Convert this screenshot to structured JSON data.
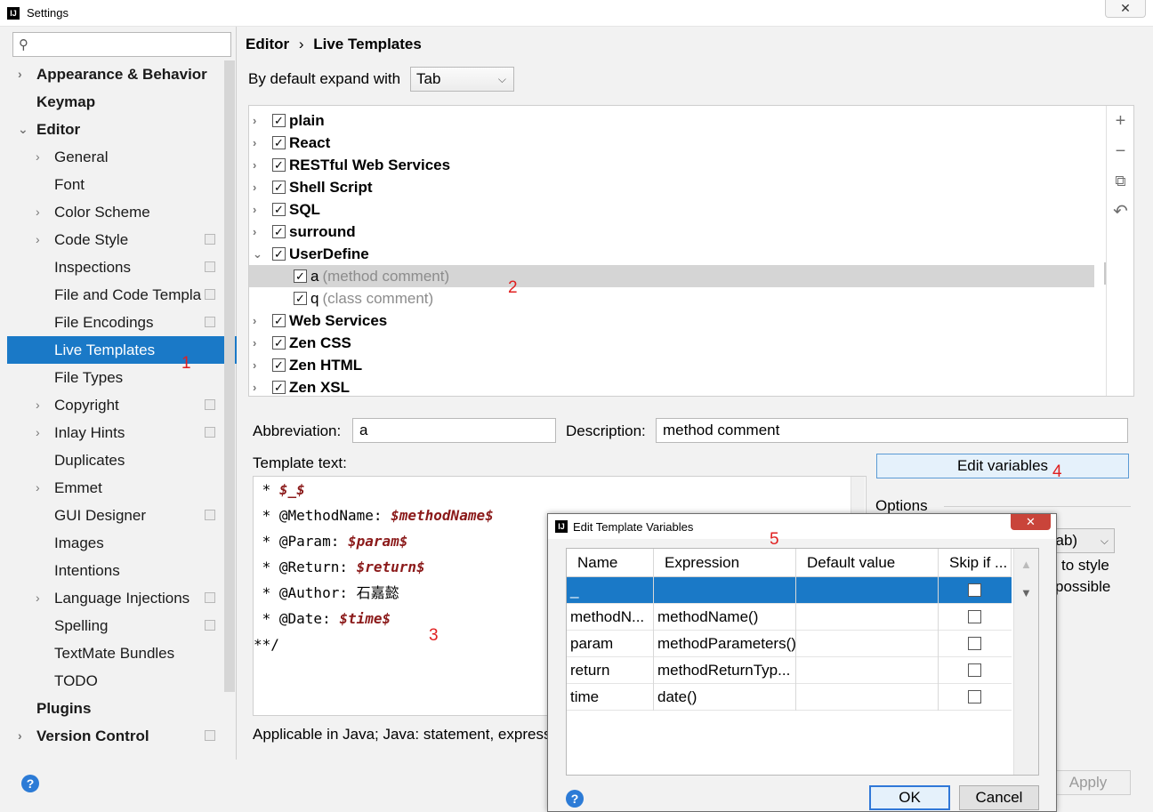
{
  "window": {
    "title": "Settings",
    "close_glyph": "✕",
    "app_icon": "IJ"
  },
  "sidebar": {
    "items": [
      {
        "label": "Appearance & Behavior",
        "level": 0,
        "bold": true,
        "chevron": "›"
      },
      {
        "label": "Keymap",
        "level": 0,
        "bold": true,
        "chevron": ""
      },
      {
        "label": "Editor",
        "level": 0,
        "bold": true,
        "chevron": "⌄"
      },
      {
        "label": "General",
        "level": 1,
        "chevron": "›"
      },
      {
        "label": "Font",
        "level": 1,
        "chevron": ""
      },
      {
        "label": "Color Scheme",
        "level": 1,
        "chevron": "›"
      },
      {
        "label": "Code Style",
        "level": 1,
        "chevron": "›",
        "proj": true
      },
      {
        "label": "Inspections",
        "level": 1,
        "chevron": "",
        "proj": true
      },
      {
        "label": "File and Code Templa",
        "level": 1,
        "chevron": "",
        "proj": true
      },
      {
        "label": "File Encodings",
        "level": 1,
        "chevron": "",
        "proj": true
      },
      {
        "label": "Live Templates",
        "level": 1,
        "chevron": "",
        "selected": true
      },
      {
        "label": "File Types",
        "level": 1,
        "chevron": ""
      },
      {
        "label": "Copyright",
        "level": 1,
        "chevron": "›",
        "proj": true
      },
      {
        "label": "Inlay Hints",
        "level": 1,
        "chevron": "›",
        "proj": true
      },
      {
        "label": "Duplicates",
        "level": 1,
        "chevron": ""
      },
      {
        "label": "Emmet",
        "level": 1,
        "chevron": "›"
      },
      {
        "label": "GUI Designer",
        "level": 1,
        "chevron": "",
        "proj": true
      },
      {
        "label": "Images",
        "level": 1,
        "chevron": ""
      },
      {
        "label": "Intentions",
        "level": 1,
        "chevron": ""
      },
      {
        "label": "Language Injections",
        "level": 1,
        "chevron": "›",
        "proj": true
      },
      {
        "label": "Spelling",
        "level": 1,
        "chevron": "",
        "proj": true
      },
      {
        "label": "TextMate Bundles",
        "level": 1,
        "chevron": ""
      },
      {
        "label": "TODO",
        "level": 1,
        "chevron": ""
      },
      {
        "label": "Plugins",
        "level": 0,
        "bold": true,
        "chevron": ""
      },
      {
        "label": "Version Control",
        "level": 0,
        "bold": true,
        "chevron": "›",
        "proj": true
      }
    ]
  },
  "breadcrumb": {
    "root": "Editor",
    "sep": "›",
    "current": "Live Templates"
  },
  "expand": {
    "label": "By default expand with",
    "value": "Tab"
  },
  "templates": [
    {
      "label": "plain",
      "group": true,
      "expanded": false
    },
    {
      "label": "React",
      "group": true,
      "expanded": false
    },
    {
      "label": "RESTful Web Services",
      "group": true,
      "expanded": false
    },
    {
      "label": "Shell Script",
      "group": true,
      "expanded": false
    },
    {
      "label": "SQL",
      "group": true,
      "expanded": false
    },
    {
      "label": "surround",
      "group": true,
      "expanded": false
    },
    {
      "label": "UserDefine",
      "group": true,
      "expanded": true
    },
    {
      "label": "a",
      "desc": "(method comment)",
      "group": false,
      "selected": true
    },
    {
      "label": "q",
      "desc": "(class comment)",
      "group": false
    },
    {
      "label": "Web Services",
      "group": true,
      "expanded": false
    },
    {
      "label": "Zen CSS",
      "group": true,
      "expanded": false
    },
    {
      "label": "Zen HTML",
      "group": true,
      "expanded": false
    },
    {
      "label": "Zen XSL",
      "group": true,
      "expanded": false
    }
  ],
  "tools": {
    "add": "+",
    "remove": "−",
    "copy": "⧉",
    "restore": "↶"
  },
  "form": {
    "abbreviation_label": "Abbreviation:",
    "abbreviation_value": "a",
    "description_label": "Description:",
    "description_value": "method comment",
    "template_text_label": "Template text:",
    "edit_variables": "Edit variables",
    "options_label": "Options",
    "options_select": "Tab)",
    "options_text1": "to style",
    "options_text2": "possible"
  },
  "template_text": [
    {
      "pre": " * ",
      "var": "$_$",
      "post": ""
    },
    {
      "pre": " * @MethodName: ",
      "var": "$methodName$",
      "post": ""
    },
    {
      "pre": " * @Param: ",
      "var": "$param$",
      "post": ""
    },
    {
      "pre": " * @Return: ",
      "var": "$return$",
      "post": ""
    },
    {
      "pre": " * @Author: 石嘉懿",
      "var": "",
      "post": ""
    },
    {
      "pre": " * @Date: ",
      "var": "$time$",
      "post": ""
    },
    {
      "pre": "**/",
      "var": "",
      "post": ""
    }
  ],
  "applicable": "Applicable in Java; Java: statement, expressi",
  "apply_label": "Apply",
  "help_glyph": "?",
  "annotations": {
    "a1": "1",
    "a2": "2",
    "a3": "3",
    "a4": "4",
    "a5": "5"
  },
  "dialog": {
    "title": "Edit Template Variables",
    "close_glyph": "✕",
    "app_icon": "IJ",
    "columns": [
      "Name",
      "Expression",
      "Default value",
      "Skip if ..."
    ],
    "rows": [
      {
        "name": "_",
        "expression": "",
        "default": "",
        "skip": false,
        "selected": true
      },
      {
        "name": "methodN...",
        "expression": "methodName()",
        "default": "",
        "skip": false
      },
      {
        "name": "param",
        "expression": "methodParameters()",
        "default": "",
        "skip": false
      },
      {
        "name": "return",
        "expression": "methodReturnTyp...",
        "default": "",
        "skip": false
      },
      {
        "name": "time",
        "expression": "date()",
        "default": "",
        "skip": false
      }
    ],
    "scroll_up": "▲",
    "scroll_down": "▼",
    "ok": "OK",
    "cancel": "Cancel"
  },
  "icons": {
    "search": "search-icon",
    "help": "help-icon",
    "check": "✓"
  }
}
